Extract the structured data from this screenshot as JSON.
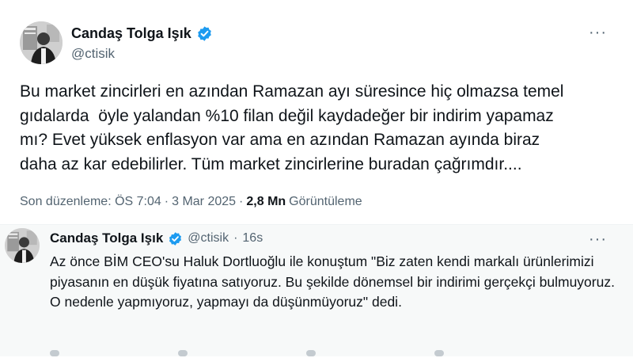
{
  "main_tweet": {
    "author_name": "Candaş Tolga Işık",
    "handle": "@ctisik",
    "text": "Bu market zincirleri en azından Ramazan ayı süresince hiç olmazsa temel\ngıdalarda  öyle yalandan %10 filan değil kaydadeğer bir indirim yapamaz\nmı? Evet yüksek enflasyon var ama en azından Ramazan ayında biraz\ndaha az kar edebilirler. Tüm market zincirlerine buradan çağrımdır....",
    "edited_label": "Son düzenleme: ÖS 7:04",
    "date": "3 Mar 2025",
    "views_count": "2,8 Mn",
    "views_label": "Görüntüleme",
    "separator": "·",
    "more_glyph": "···"
  },
  "reply_tweet": {
    "author_name": "Candaş Tolga Işık",
    "handle": "@ctisik",
    "separator": "·",
    "time": "16s",
    "text": "Az önce BİM CEO'su Haluk Dortluoğlu ile konuştum \"Biz zaten kendi markalı ürünlerimizi piyasanın en düşük fiyatına satıyoruz. Bu şekilde dönemsel bir indirimi gerçekçi bulmuyoruz. O nedenle yapmıyoruz, yapmayı da düşünmüyoruz\" dedi.",
    "more_glyph": "···"
  },
  "icons": {
    "verified": "verified-badge-icon",
    "more": "more-options-icon"
  },
  "colors": {
    "verified_blue": "#1d9bf0",
    "text_primary": "#0f1419",
    "text_secondary": "#536471",
    "reply_background": "#f7f9f9"
  }
}
